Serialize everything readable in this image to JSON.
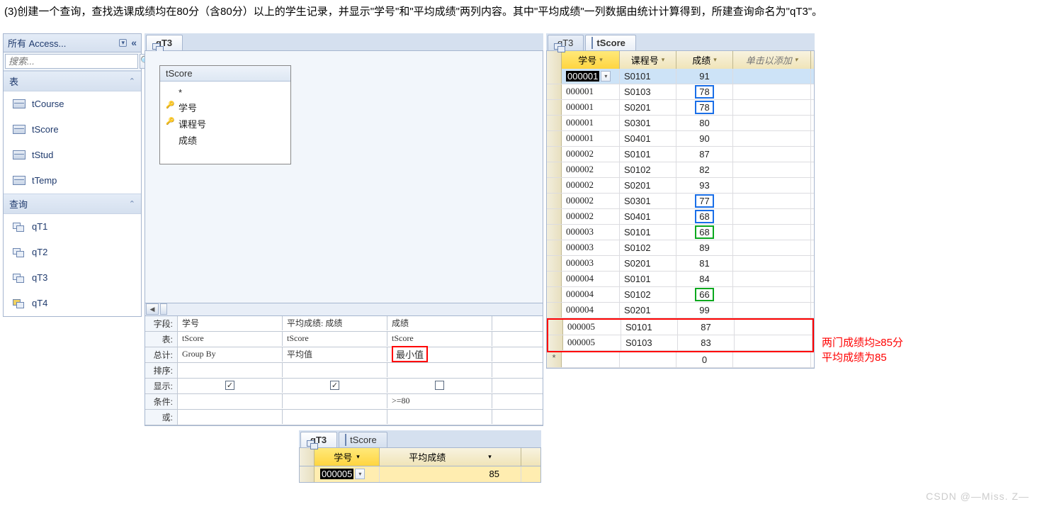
{
  "instruction": "(3)创建一个查询，查找选课成绩均在80分（含80分）以上的学生记录，并显示\"学号\"和\"平均成绩\"两列内容。其中\"平均成绩\"一列数据由统计计算得到，所建查询命名为\"qT3\"。",
  "nav": {
    "title": "所有 Access...",
    "search_placeholder": "搜索...",
    "sections": {
      "tables": {
        "label": "表",
        "items": [
          "tCourse",
          "tScore",
          "tStud",
          "tTemp"
        ]
      },
      "queries": {
        "label": "查询",
        "items": [
          "qT1",
          "qT2",
          "qT3",
          "qT4"
        ]
      }
    }
  },
  "design": {
    "tab": "qT3",
    "source_table": {
      "name": "tScore",
      "fields": [
        "*",
        "学号",
        "课程号",
        "成绩"
      ],
      "keys": [
        1,
        2
      ]
    },
    "grid": {
      "labels": {
        "field": "字段:",
        "table": "表:",
        "total": "总计:",
        "sort": "排序:",
        "show": "显示:",
        "criteria": "条件:",
        "or": "或:"
      },
      "cols": [
        {
          "field": "学号",
          "table": "tScore",
          "total": "Group By",
          "show": true,
          "criteria": ""
        },
        {
          "field": "平均成绩: 成绩",
          "table": "tScore",
          "total": "平均值",
          "show": true,
          "criteria": ""
        },
        {
          "field": "成绩",
          "table": "tScore",
          "total": "最小值",
          "show": false,
          "criteria": ">=80"
        }
      ]
    }
  },
  "datasheet": {
    "tabs": [
      "qT3",
      "tScore"
    ],
    "headers": {
      "id": "学号",
      "course": "课程号",
      "score": "成绩",
      "add": "单击以添加"
    },
    "rows": [
      {
        "id": "000001",
        "course": "S0101",
        "score": 91,
        "sel": true,
        "first": true
      },
      {
        "id": "000001",
        "course": "S0103",
        "score": 78,
        "box": "blue"
      },
      {
        "id": "000001",
        "course": "S0201",
        "score": 78,
        "box": "blue"
      },
      {
        "id": "000001",
        "course": "S0301",
        "score": 80
      },
      {
        "id": "000001",
        "course": "S0401",
        "score": 90
      },
      {
        "id": "000002",
        "course": "S0101",
        "score": 87
      },
      {
        "id": "000002",
        "course": "S0102",
        "score": 82
      },
      {
        "id": "000002",
        "course": "S0201",
        "score": 93
      },
      {
        "id": "000002",
        "course": "S0301",
        "score": 77,
        "box": "blue"
      },
      {
        "id": "000002",
        "course": "S0401",
        "score": 68,
        "box": "blue"
      },
      {
        "id": "000003",
        "course": "S0101",
        "score": 68,
        "box": "green"
      },
      {
        "id": "000003",
        "course": "S0102",
        "score": 89
      },
      {
        "id": "000003",
        "course": "S0201",
        "score": 81
      },
      {
        "id": "000004",
        "course": "S0101",
        "score": 84
      },
      {
        "id": "000004",
        "course": "S0102",
        "score": 66,
        "box": "green"
      },
      {
        "id": "000004",
        "course": "S0201",
        "score": 99
      },
      {
        "id": "000005",
        "course": "S0101",
        "score": 87,
        "group": "red"
      },
      {
        "id": "000005",
        "course": "S0103",
        "score": 83,
        "group": "red"
      }
    ],
    "new_row_score": 0
  },
  "annotation": {
    "line1": "两门成绩均≥85分",
    "line2": "平均成绩为85"
  },
  "result": {
    "tabs": [
      "qT3",
      "tScore"
    ],
    "headers": {
      "id": "学号",
      "avg": "平均成绩"
    },
    "row": {
      "id": "000005",
      "avg": 85
    }
  },
  "watermark": "CSDN @—Miss. Z—"
}
